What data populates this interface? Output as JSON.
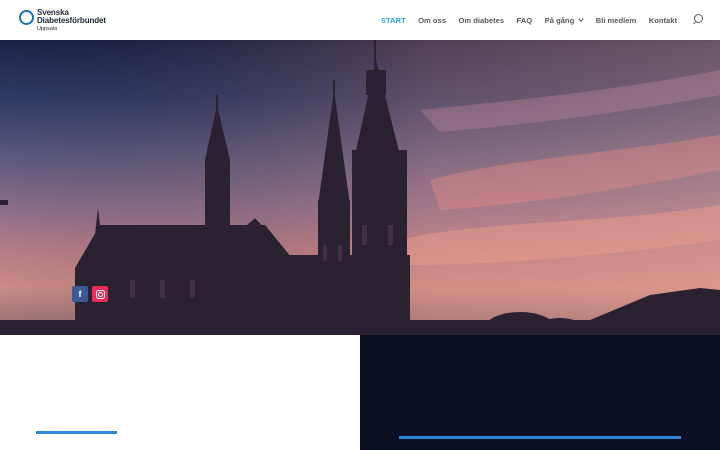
{
  "brand": {
    "line1": "Svenska",
    "line2": "Diabetesförbundet",
    "line3": "Uppsala",
    "color": "#1a6fb5"
  },
  "nav": {
    "items": [
      {
        "label": "START",
        "active": true
      },
      {
        "label": "Om oss"
      },
      {
        "label": "Om diabetes"
      },
      {
        "label": "FAQ"
      },
      {
        "label": "På gång",
        "has_dropdown": true
      },
      {
        "label": "Bli medlem"
      },
      {
        "label": "Kontakt"
      }
    ],
    "active_color": "#2ea3f2",
    "search_icon": "search-icon"
  },
  "social": {
    "facebook_icon": "facebook-icon",
    "facebook_glyph": "f",
    "facebook_color": "#3b5998",
    "instagram_icon": "instagram-icon",
    "instagram_color": "#ea2c59"
  },
  "colors": {
    "divider": "#2b87da",
    "dark_panel": "#0b0f24"
  }
}
